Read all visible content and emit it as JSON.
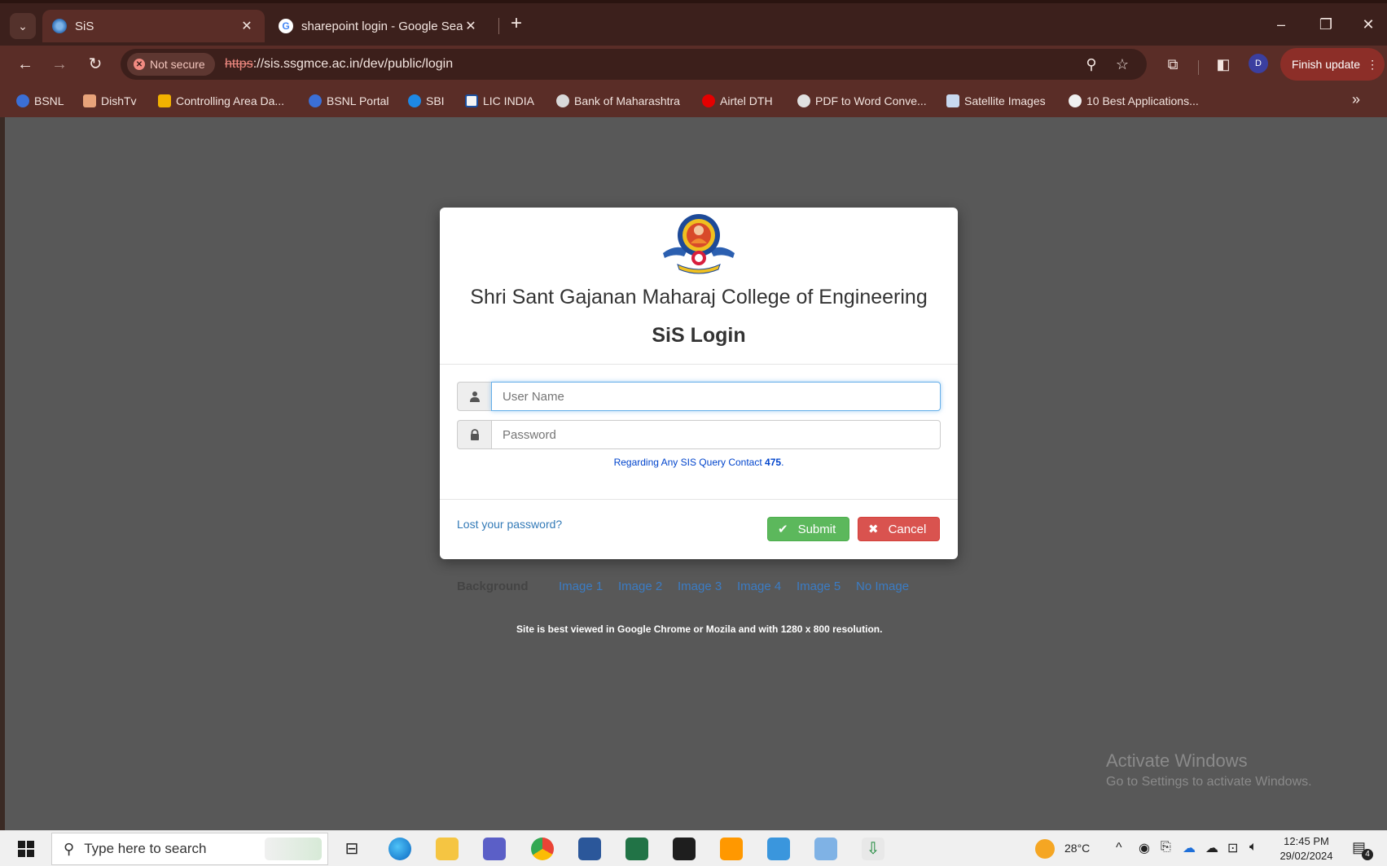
{
  "browser": {
    "tabs": [
      {
        "title": "SiS",
        "active": true
      },
      {
        "title": "sharepoint login - Google Searc",
        "active": false
      }
    ],
    "security_label": "Not secure",
    "url_scheme": "https",
    "url_rest": "://sis.ssgmce.ac.in/dev/public/login",
    "profile_initial": "D",
    "finish_update_label": "Finish update",
    "bookmarks": [
      "BSNL",
      "DishTv",
      "Controlling Area Da...",
      "BSNL Portal",
      "SBI",
      "LIC INDIA",
      "Bank of Maharashtra",
      "Airtel DTH",
      "PDF to Word Conve...",
      "Satellite Images",
      "10 Best Applications..."
    ]
  },
  "login": {
    "college_name": "Shri Sant Gajanan Maharaj College of Engineering",
    "title": "SiS Login",
    "username_placeholder": "User Name",
    "password_placeholder": "Password",
    "query_text": "Regarding Any SIS Query Contact",
    "query_number": "475",
    "query_suffix": ".",
    "lost_password": "Lost your password?",
    "submit_label": "Submit",
    "cancel_label": "Cancel"
  },
  "background": {
    "label": "Background",
    "options": [
      "Image 1",
      "Image 2",
      "Image 3",
      "Image 4",
      "Image 5",
      "No Image"
    ]
  },
  "notice": "Site is best viewed in Google Chrome or Mozila and with 1280 x 800 resolution.",
  "watermark": {
    "line1": "Activate Windows",
    "line2": "Go to Settings to activate Windows."
  },
  "taskbar": {
    "search_placeholder": "Type here to search",
    "temperature": "28°C",
    "time": "12:45 PM",
    "date": "29/02/2024",
    "notification_count": "4"
  },
  "colors": {
    "chrome_frame": "#3c201c",
    "chrome_toolbar": "#5a2d27",
    "page_background": "#585858",
    "submit": "#5cb85c",
    "cancel": "#d9534f",
    "link": "#337ab7"
  }
}
